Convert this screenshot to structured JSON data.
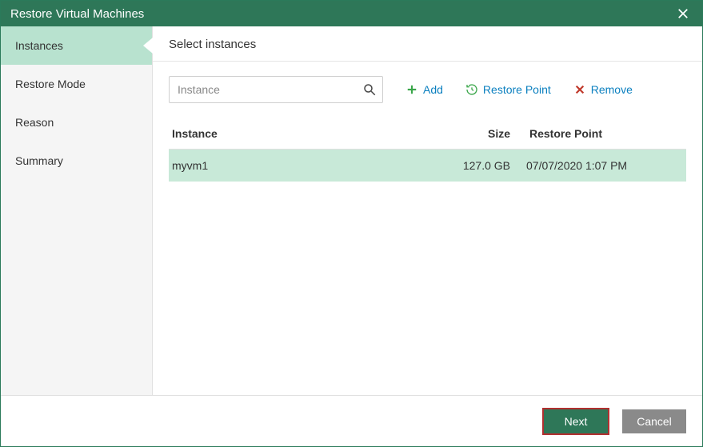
{
  "window": {
    "title": "Restore Virtual Machines"
  },
  "sidebar": {
    "items": [
      {
        "label": "Instances",
        "active": true
      },
      {
        "label": "Restore Mode",
        "active": false
      },
      {
        "label": "Reason",
        "active": false
      },
      {
        "label": "Summary",
        "active": false
      }
    ]
  },
  "header": {
    "title": "Select instances"
  },
  "search": {
    "placeholder": "Instance"
  },
  "toolbar": {
    "add_label": "Add",
    "restore_point_label": "Restore Point",
    "remove_label": "Remove"
  },
  "table": {
    "columns": {
      "instance": "Instance",
      "size": "Size",
      "restore_point": "Restore Point"
    },
    "rows": [
      {
        "instance": "myvm1",
        "size": "127.0 GB",
        "restore_point": "07/07/2020 1:07 PM"
      }
    ]
  },
  "footer": {
    "next": "Next",
    "cancel": "Cancel"
  }
}
